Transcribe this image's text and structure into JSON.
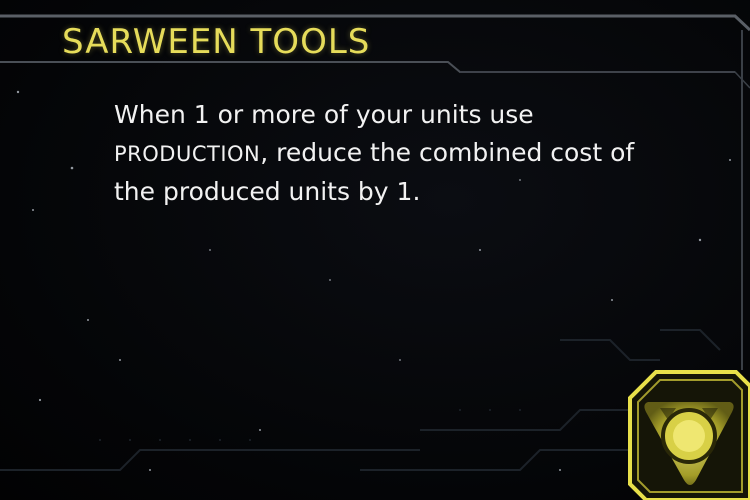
{
  "card": {
    "title": "SARWEEN TOOLS",
    "ability": {
      "line1": "When 1 or more of your units use",
      "keyword": "PRODUCTION",
      "line2_rest": ", reduce the combined cost of",
      "line3": "the produced units by 1."
    },
    "emblem_icon": "faction-emblem-icon",
    "colors": {
      "title": "#e6dc5a",
      "text": "#f2f2f2",
      "frame": "#5a5f66",
      "emblem": "#e8e04a",
      "background": "#050608"
    }
  }
}
